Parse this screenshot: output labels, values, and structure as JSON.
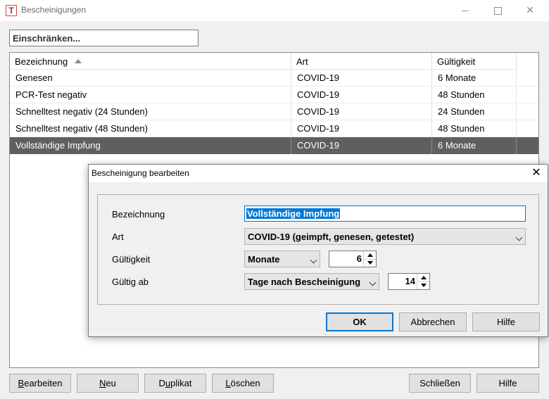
{
  "window": {
    "title": "Bescheinigungen",
    "icon_letter": "T",
    "close_glyph": "✕"
  },
  "filter": {
    "placeholder": "Einschränken..."
  },
  "list": {
    "columns": [
      "Bezeichnung",
      "Art",
      "Gültigkeit"
    ],
    "sort_column": "Bezeichnung",
    "rows": [
      [
        "Genesen",
        "COVID-19",
        "6 Monate"
      ],
      [
        "PCR-Test negativ",
        "COVID-19",
        "48 Stunden"
      ],
      [
        "Schnelltest negativ (24 Stunden)",
        "COVID-19",
        "24 Stunden"
      ],
      [
        "Schnelltest negativ (48 Stunden)",
        "COVID-19",
        "48 Stunden"
      ],
      [
        "Vollständige Impfung",
        "COVID-19",
        "6 Monate"
      ]
    ],
    "selected_row": 4
  },
  "buttons": {
    "bearbeiten": {
      "first": "B",
      "rest": "earbeiten"
    },
    "neu": {
      "first": "N",
      "rest": "eu"
    },
    "duplikat": {
      "pre": "D",
      "under": "u",
      "rest": "plikat"
    },
    "loeschen": {
      "first": "L",
      "rest": "öschen"
    },
    "schliessen": "Schließen",
    "hilfe": "Hilfe"
  },
  "dialog": {
    "title": "Bescheinigung bearbeiten",
    "close_glyph": "✕",
    "labels": {
      "bezeichnung": "Bezeichnung",
      "art": "Art",
      "gueltigkeit": "Gültigkeit",
      "gueltig_ab": "Gültig ab"
    },
    "values": {
      "bezeichnung": "Vollständige Impfung",
      "art": "COVID-19 (geimpft, genesen, getestet)",
      "gueltigkeit_unit": "Monate",
      "gueltigkeit_amount": "6",
      "gueltig_ab_mode": "Tage nach Bescheinigung",
      "gueltig_ab_amount": "14"
    },
    "buttons": {
      "ok": "OK",
      "abbrechen": "Abbrechen",
      "hilfe": "Hilfe"
    }
  },
  "colors": {
    "selection": "#5f5f5f",
    "focus_accent": "#0078d7"
  }
}
